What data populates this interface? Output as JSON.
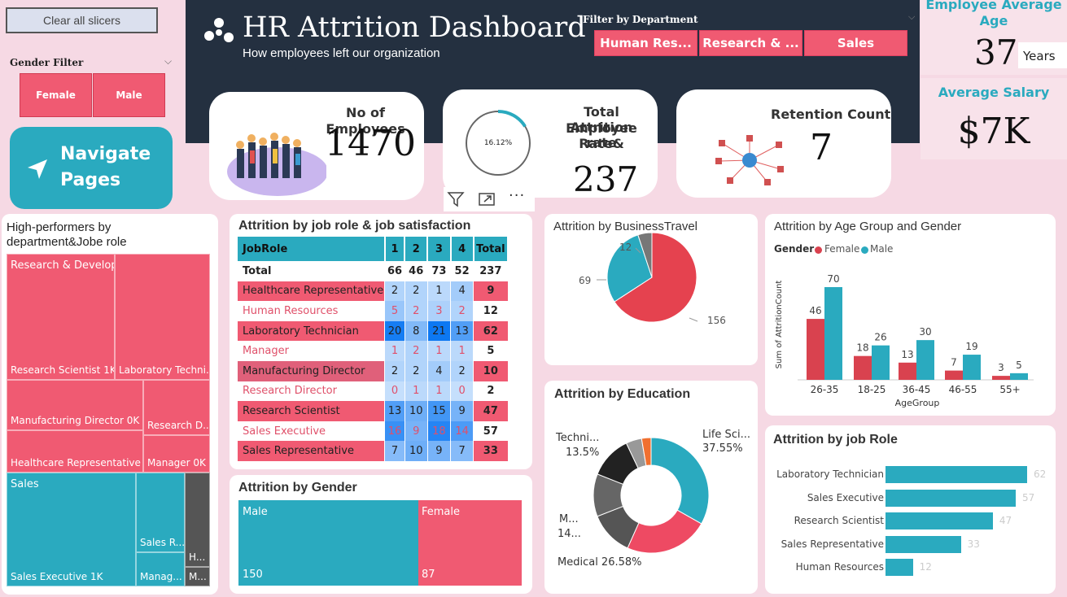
{
  "slicers": {
    "clear_label": "Clear all slicers",
    "gender_title": "Gender Filter",
    "female": "Female",
    "male": "Male",
    "nav_line1": "Navigate",
    "nav_line2": "Pages"
  },
  "header": {
    "title": "HR Attrition Dashboard",
    "subtitle": "How employees left our organization",
    "dept_filter_title": "Filter by Department",
    "dept_buttons": [
      "Human Res...",
      "Research & ...",
      "Sales"
    ]
  },
  "avg_age": {
    "title_line1": "Employee Average",
    "title_line2": "Age",
    "value": "37",
    "unit": "Years"
  },
  "avg_salary": {
    "title": "Average Salary",
    "value": "$7K"
  },
  "kpis": {
    "employees_title": "No of Employees",
    "employees_value": "1470",
    "attrition_title_line1": "Total Employee",
    "attrition_title_line2": "Attrition Rate&",
    "attrition_title_line3": "rate",
    "attrition_rate": "16.12%",
    "attrition_rate_fraction": 0.1612,
    "attrition_value": "237",
    "retention_title": "Retention Count",
    "retention_value": "7"
  },
  "treemap": {
    "title_line1": "High-performers by",
    "title_line2": "department&Jobe role",
    "cells": {
      "rd": "Research & Development",
      "rs": "Research Scientist 1K",
      "lt": "Laboratory Techni...",
      "md": "Manufacturing Director 0K",
      "rdd": "Research D...",
      "hr": "Healthcare Representative 0K",
      "mg": "Manager 0K",
      "sales": "Sales",
      "sr": "Sales R...",
      "h": "H...",
      "se": "Sales Executive 1K",
      "mn": "Manag...",
      "m": "M..."
    }
  },
  "job_table": {
    "title": "Attrition by job role & job satisfaction",
    "headers": [
      "JobRole",
      "1",
      "2",
      "3",
      "4",
      "Total"
    ],
    "rows": [
      [
        "Total",
        "66",
        "46",
        "73",
        "52",
        "237"
      ],
      [
        "Healthcare Representative",
        "2",
        "2",
        "1",
        "4",
        "9"
      ],
      [
        "Human Resources",
        "5",
        "2",
        "3",
        "2",
        "12"
      ],
      [
        "Laboratory Technician",
        "20",
        "8",
        "21",
        "13",
        "62"
      ],
      [
        "Manager",
        "1",
        "2",
        "1",
        "1",
        "5"
      ],
      [
        "Manufacturing Director",
        "2",
        "2",
        "4",
        "2",
        "10"
      ],
      [
        "Research Director",
        "0",
        "1",
        "1",
        "0",
        "2"
      ],
      [
        "Research Scientist",
        "13",
        "10",
        "15",
        "9",
        "47"
      ],
      [
        "Sales Executive",
        "16",
        "9",
        "18",
        "14",
        "57"
      ],
      [
        "Sales Representative",
        "7",
        "10",
        "9",
        "7",
        "33"
      ]
    ]
  },
  "gender_chart": {
    "title": "Attrition by Gender",
    "male_label": "Male",
    "male_value": "150",
    "female_label": "Female",
    "female_value": "87"
  },
  "travel_chart": {
    "title": "Attrition by BusinessTravel",
    "labels": [
      "156",
      "69",
      "12"
    ]
  },
  "education_chart": {
    "title": "Attrition by Education",
    "labels": {
      "life_sci": "Life Sci...",
      "life_sci_pct": "37.55%",
      "medical": "Medical 26.58%",
      "m1": "M...",
      "m2": "14...",
      "techni": "Techni...",
      "techni_pct": "13.5%"
    }
  },
  "age_chart": {
    "title": "Attrition by Age Group and Gender",
    "legend_title": "Gender",
    "legend_female": "Female",
    "legend_male": "Male",
    "ylabel": "Sum of AttritionCount",
    "xlabel": "AgeGroup"
  },
  "role_chart": {
    "title": "Attrition by job Role"
  },
  "colors": {
    "pink": "#f05a72",
    "teal": "#2aaabf",
    "navy": "#243040",
    "dark": "#555555"
  },
  "chart_data": [
    {
      "type": "pie",
      "title": "Attrition by BusinessTravel",
      "values": [
        156,
        69,
        12
      ],
      "colors": [
        "#e5424f",
        "#2aaabf",
        "#777777"
      ]
    },
    {
      "type": "pie",
      "title": "Attrition by Education",
      "donut": true,
      "values": [
        37.55,
        26.58,
        14,
        13.5,
        13.5,
        5,
        3
      ],
      "labels": [
        "Life Sci...",
        "Medical",
        "M...",
        "Techni...",
        "",
        "",
        ""
      ],
      "colors": [
        "#2aaabf",
        "#ee4a63",
        "#555555",
        "#666666",
        "#222222",
        "#999999",
        "#f07030"
      ]
    },
    {
      "type": "bar",
      "title": "Attrition by Age Group and Gender",
      "categories": [
        "26-35",
        "18-25",
        "36-45",
        "46-55",
        "55+"
      ],
      "series": [
        {
          "name": "Female",
          "values": [
            46,
            18,
            13,
            7,
            3
          ]
        },
        {
          "name": "Male",
          "values": [
            70,
            26,
            30,
            19,
            5
          ]
        }
      ],
      "xlabel": "AgeGroup",
      "ylabel": "Sum of AttritionCount"
    },
    {
      "type": "bar",
      "orientation": "horizontal",
      "title": "Attrition by job Role",
      "categories": [
        "Laboratory Technician",
        "Sales Executive",
        "Research Scientist",
        "Sales Representative",
        "Human Resources"
      ],
      "values": [
        62,
        57,
        47,
        33,
        12
      ]
    },
    {
      "type": "table",
      "title": "Attrition by job role & job satisfaction"
    }
  ]
}
